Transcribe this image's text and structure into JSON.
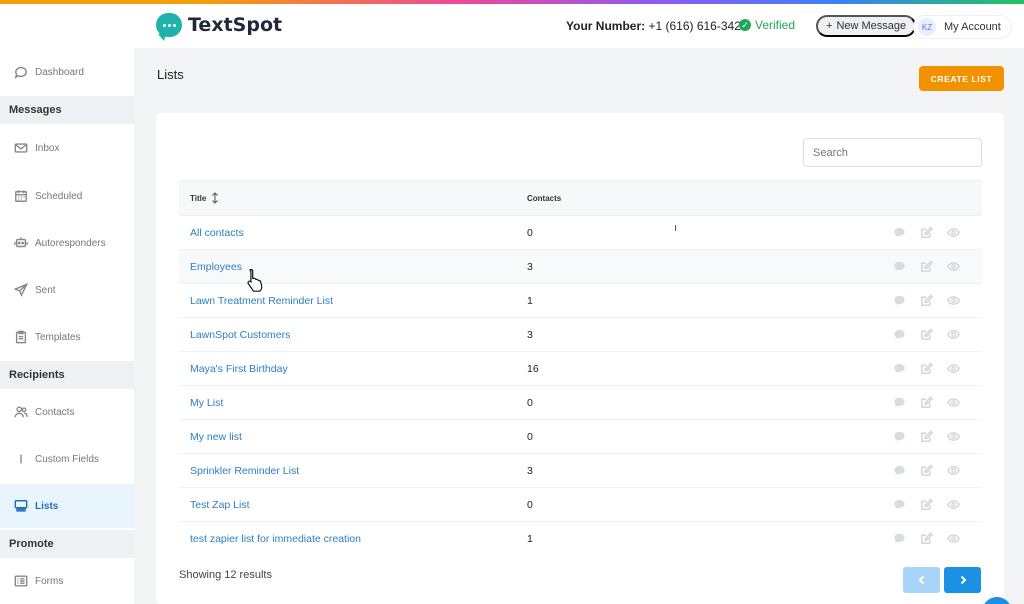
{
  "app": {
    "name": "TextSpot"
  },
  "header": {
    "number_label": "Your Number:",
    "number_value": "+1 (616) 616-3422",
    "verified_label": "Verified",
    "new_message_label": "New Message",
    "new_message_prefix": "+",
    "account_initials": "KZ",
    "account_label": "My Account"
  },
  "sidebar": {
    "dashboard": "Dashboard",
    "messages_heading": "Messages",
    "inbox": "Inbox",
    "scheduled": "Scheduled",
    "autoresponders": "Autoresponders",
    "sent": "Sent",
    "templates": "Templates",
    "recipients_heading": "Recipients",
    "contacts": "Contacts",
    "custom_fields": "Custom Fields",
    "lists": "Lists",
    "promote_heading": "Promote",
    "forms": "Forms"
  },
  "page": {
    "title": "Lists",
    "create_label": "CREATE LIST",
    "search_placeholder": "Search",
    "showing_text": "Showing 12 results"
  },
  "table": {
    "col_title": "Title",
    "col_contacts": "Contacts",
    "rows": [
      {
        "title": "All contacts",
        "contacts": "0"
      },
      {
        "title": "Employees",
        "contacts": "3"
      },
      {
        "title": "Lawn Treatment Reminder List",
        "contacts": "1"
      },
      {
        "title": "LawnSpot Customers",
        "contacts": "3"
      },
      {
        "title": "Maya's First Birthday",
        "contacts": "16"
      },
      {
        "title": "My List",
        "contacts": "0"
      },
      {
        "title": "My new list",
        "contacts": "0"
      },
      {
        "title": "Sprinkler Reminder List",
        "contacts": "3"
      },
      {
        "title": "Test Zap List",
        "contacts": "0"
      },
      {
        "title": "test zapier list for immediate creation",
        "contacts": "1"
      }
    ]
  },
  "colors": {
    "accent": "#f39200",
    "link": "#2d7fc0",
    "primary": "#1c91e4",
    "verified": "#22a857"
  },
  "icons": [
    "chat-icon",
    "mail-icon",
    "calendar-icon",
    "robot-icon",
    "send-icon",
    "clipboard-icon",
    "users-icon",
    "list-icon",
    "form-icon",
    "sort-icon",
    "message-icon",
    "edit-icon",
    "eye-icon",
    "chevron-left-icon",
    "chevron-right-icon",
    "pointer-cursor-icon"
  ]
}
